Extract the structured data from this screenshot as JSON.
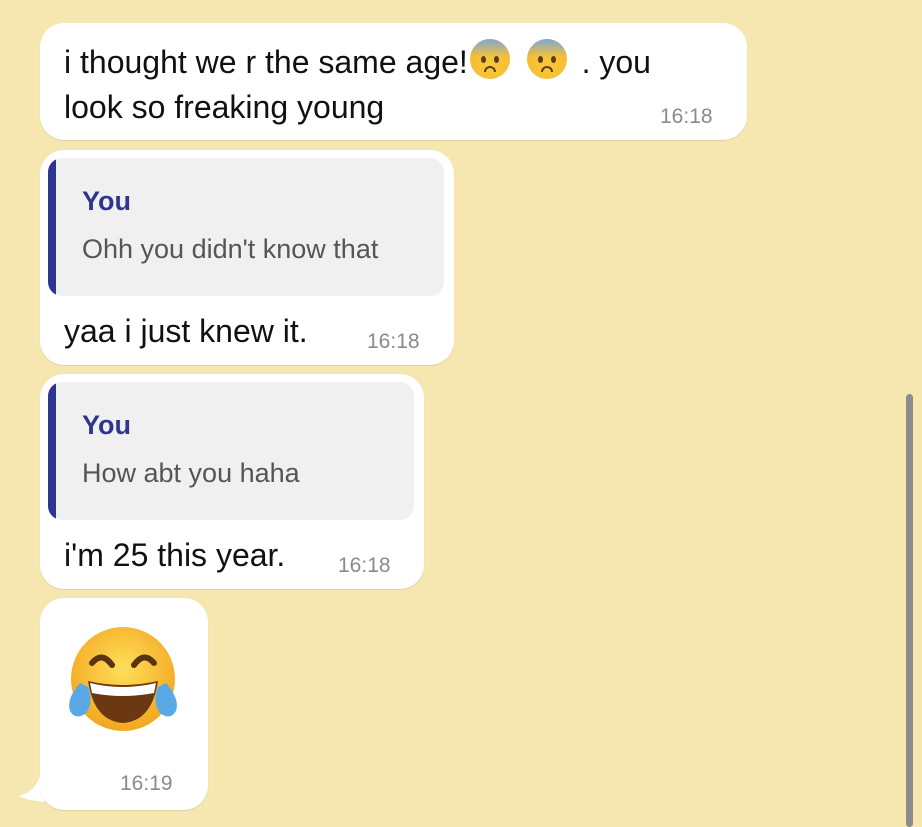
{
  "messages": [
    {
      "type": "text",
      "line1_before": "i thought we r the same age!",
      "line1_after": ". you",
      "line2": "look so freaking young",
      "time": "16:18"
    },
    {
      "type": "reply",
      "quote_author": "You",
      "quote_text": "Ohh you didn't know that",
      "text": "yaa i just knew it.",
      "time": "16:18"
    },
    {
      "type": "reply",
      "quote_author": "You",
      "quote_text": "How abt you haha",
      "text": "i'm 25 this year.",
      "time": "16:18"
    },
    {
      "type": "emoji",
      "emoji": "face-with-tears-of-joy",
      "time": "16:19"
    }
  ],
  "colors": {
    "background": "#f5e7af",
    "bubble": "#ffffff",
    "quote_accent": "#2f3690",
    "quote_background": "#f0f0f0",
    "timestamp": "#8a8a8a"
  },
  "icons": [
    "anxious-face-icon",
    "face-with-tears-of-joy-icon"
  ]
}
